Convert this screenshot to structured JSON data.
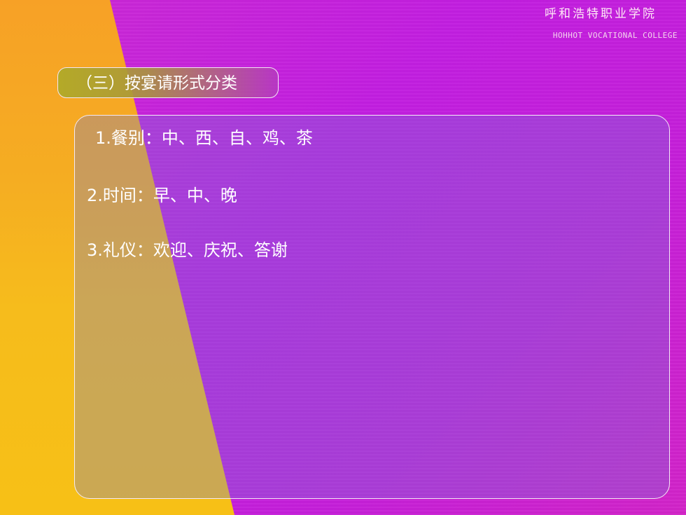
{
  "header": {
    "institution_cn": "呼和浩特职业学院",
    "institution_en": "HOHHOT VOCATIONAL COLLEGE"
  },
  "slide": {
    "section_title": "（三）按宴请形式分类",
    "items": [
      {
        "text": "1.餐别：中、西、自、鸡、茶"
      },
      {
        "text": "2.时间：早、中、晚"
      },
      {
        "text": "3.礼仪：欢迎、庆祝、答谢"
      }
    ]
  },
  "colors": {
    "magenta_background": "#c81fd8",
    "yellow_wedge": "#f6b020",
    "text": "#ffffff"
  }
}
